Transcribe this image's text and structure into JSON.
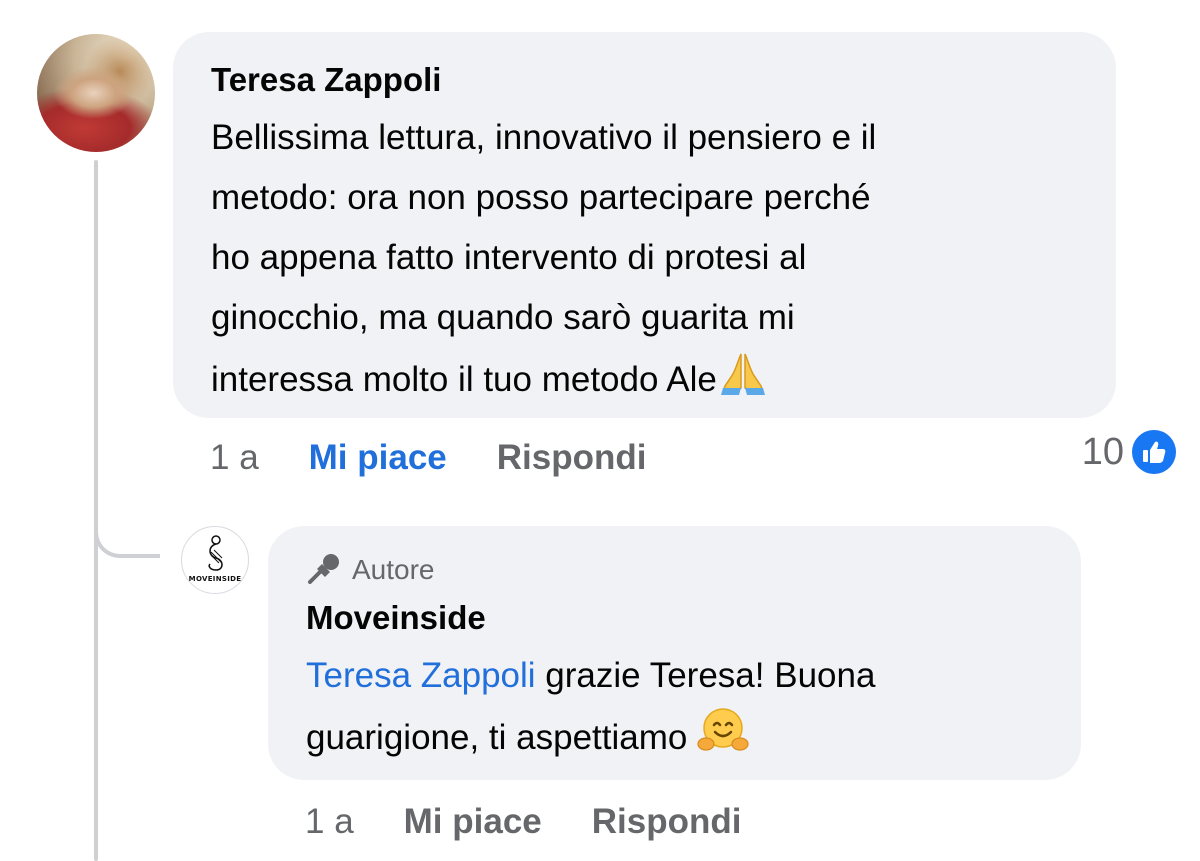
{
  "comment": {
    "author": "Teresa Zappoli",
    "text_lines": [
      "Bellissima lettura, innovativo il pensiero e il",
      "metodo: ora non posso partecipare perché",
      "ho appena fatto intervento di protesi al",
      "ginocchio, ma quando sarò guarita mi",
      "interessa molto il tuo metodo Ale"
    ],
    "emoji": "folded-hands",
    "time": "1 a",
    "like_label": "Mi piace",
    "reply_label": "Rispondi",
    "reaction_count": "10",
    "reaction_type": "like",
    "liked_color": "#216fdb"
  },
  "reply": {
    "badge_label": "Autore",
    "badge_icon": "microphone-icon",
    "author": "Moveinside",
    "logo_text": "MOVEINSIDE",
    "mention": "Teresa Zappoli",
    "text_first": " grazie Teresa! Buona",
    "text_second": "guarigione, ti aspettiamo",
    "emoji": "hugging-face",
    "time": "1 a",
    "like_label": "Mi piace",
    "reply_label": "Rispondi"
  },
  "colors": {
    "bubble": "#f0f2f5",
    "secondary_text": "#65676b",
    "link": "#216fdb",
    "like_badge": "#1877f2",
    "thread_line": "#ced0d4"
  }
}
